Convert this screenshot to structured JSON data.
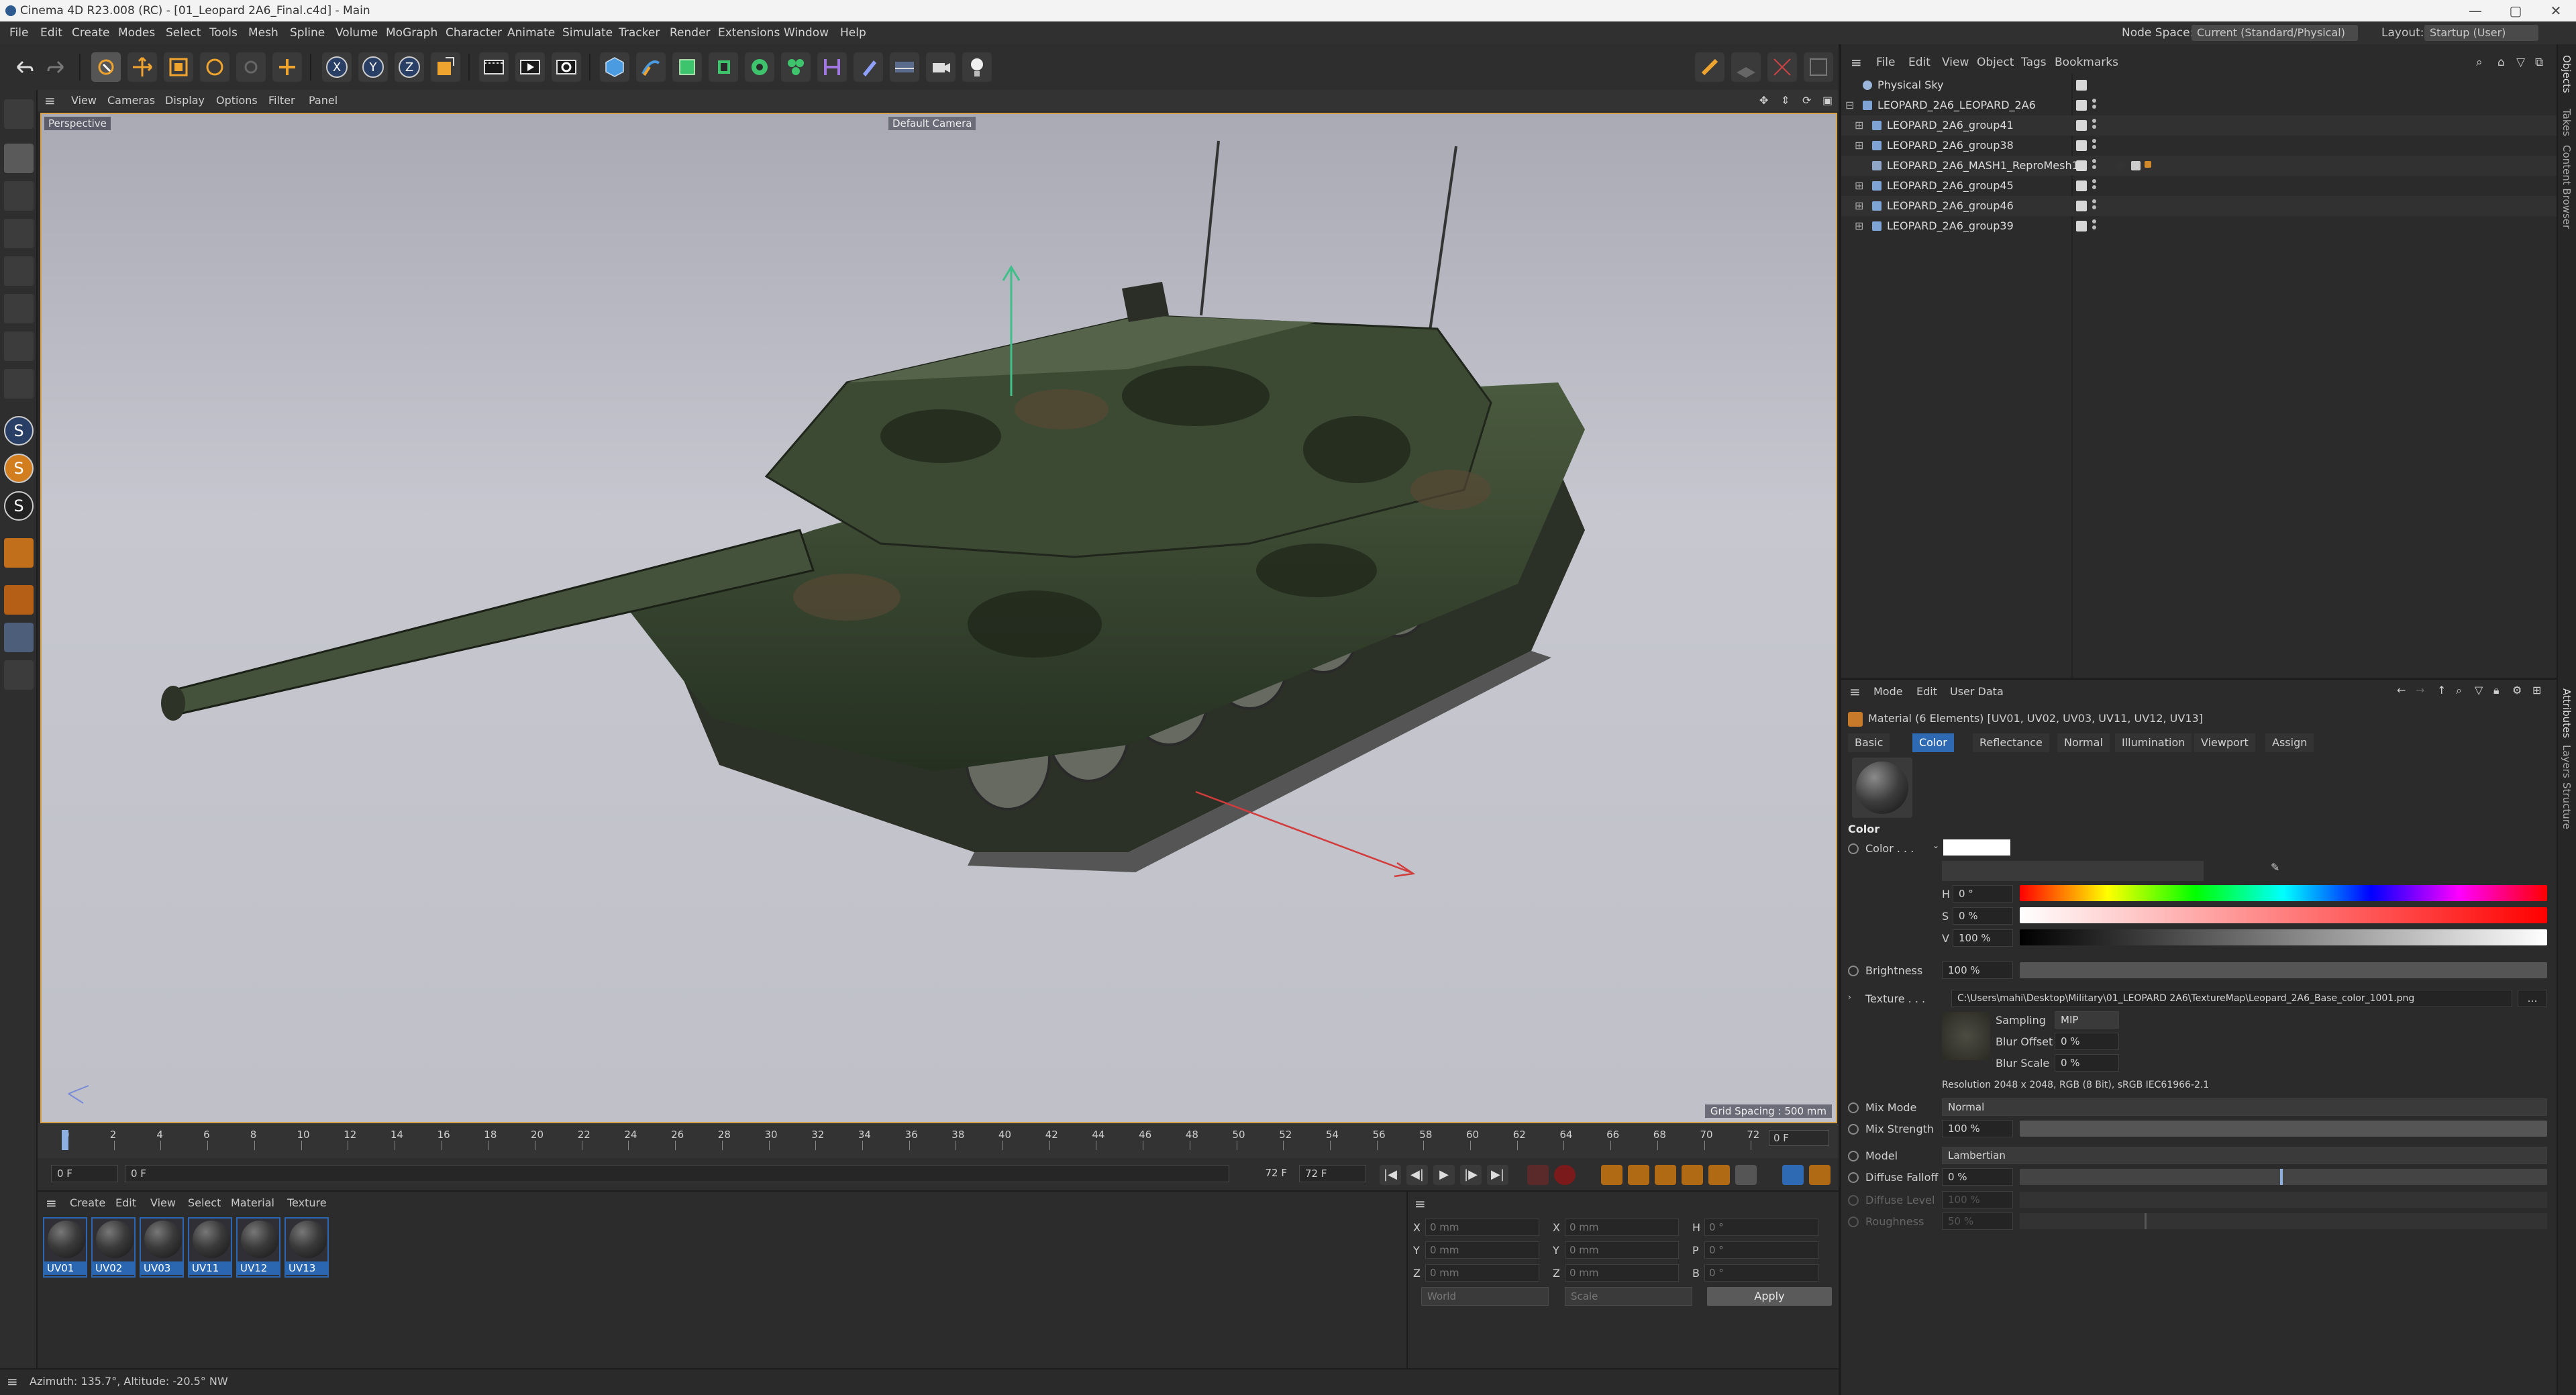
{
  "window": {
    "title": "Cinema 4D R23.008 (RC) - [01_Leopard 2A6_Final.c4d] - Main",
    "controls": [
      "—",
      "▢",
      "✕"
    ]
  },
  "menubar": {
    "items": [
      "File",
      "Edit",
      "Create",
      "Modes",
      "Select",
      "Tools",
      "Mesh",
      "Spline",
      "Volume",
      "MoGraph",
      "Character",
      "Animate",
      "Simulate",
      "Tracker",
      "Render",
      "Extensions",
      "Window",
      "Help"
    ],
    "node_space_label": "Node Space:",
    "node_space_value": "Current (Standard/Physical)",
    "layout_label": "Layout:",
    "layout_value": "Startup (User)"
  },
  "toolbar": {
    "axis_x": "X",
    "axis_y": "Y",
    "axis_z": "Z",
    "icons": [
      "undo-icon",
      "redo-icon",
      "select-icon",
      "move-icon",
      "scale-icon",
      "rotate-icon",
      "live-select-icon",
      "add-icon",
      "x-axis-icon",
      "y-axis-icon",
      "z-axis-icon",
      "coord-system-icon",
      "render-region-icon",
      "render-view-icon",
      "render-settings-icon",
      "cube-icon",
      "pen-icon",
      "subdivision-icon",
      "extrude-icon",
      "cloner-icon",
      "mograph-icon",
      "deformer-icon",
      "field-icon",
      "environment-icon",
      "camera-icon",
      "light-icon"
    ]
  },
  "lefttools": {
    "snap_labels": [
      "S",
      "S",
      "S"
    ]
  },
  "viewport": {
    "menu": [
      "View",
      "Cameras",
      "Display",
      "Options",
      "Filter",
      "Panel"
    ],
    "view_name": "Perspective",
    "camera": "Default Camera",
    "grid_spacing": "Grid Spacing : 500 mm",
    "colors": {
      "axis_y": "#3fbf8a",
      "axis_x": "#d23c3c"
    }
  },
  "timeline": {
    "ticks": [
      "0",
      "2",
      "4",
      "6",
      "8",
      "10",
      "12",
      "14",
      "16",
      "18",
      "20",
      "22",
      "24",
      "26",
      "28",
      "30",
      "32",
      "34",
      "36",
      "38",
      "40",
      "42",
      "44",
      "46",
      "48",
      "50",
      "52",
      "54",
      "56",
      "58",
      "60",
      "62",
      "64",
      "66",
      "68",
      "70",
      "72"
    ],
    "current_frame": "0 F",
    "start_field": "0 F",
    "min_field": "0 F",
    "end_field": "72 F",
    "max_field": "72 F",
    "transport": [
      "|◀",
      "◀|",
      "▶",
      "|▶",
      "▶|"
    ]
  },
  "material_manager": {
    "menu": [
      "Create",
      "Edit",
      "View",
      "Select",
      "Material",
      "Texture"
    ],
    "materials": [
      "UV01",
      "UV02",
      "UV03",
      "UV11",
      "UV12",
      "UV13"
    ]
  },
  "coordinates": {
    "rows": [
      {
        "a_label": "X",
        "a_value": "0 mm",
        "b_label": "X",
        "b_value": "0 mm",
        "c_label": "H",
        "c_value": "0 °"
      },
      {
        "a_label": "Y",
        "a_value": "0 mm",
        "b_label": "Y",
        "b_value": "0 mm",
        "c_label": "P",
        "c_value": "0 °"
      },
      {
        "a_label": "Z",
        "a_value": "0 mm",
        "b_label": "Z",
        "b_value": "0 mm",
        "c_label": "B",
        "c_value": "0 °"
      }
    ],
    "space": "World",
    "mode": "Scale",
    "apply": "Apply"
  },
  "status": {
    "text": "Azimuth: 135.7°, Altitude: -20.5°  NW"
  },
  "object_manager": {
    "menu": [
      "File",
      "Edit",
      "View",
      "Object",
      "Tags",
      "Bookmarks"
    ],
    "objects": [
      {
        "name": "Physical Sky",
        "indent": 0
      },
      {
        "name": "LEOPARD_2A6_LEOPARD_2A6",
        "indent": 0
      },
      {
        "name": "LEOPARD_2A6_group41",
        "indent": 1
      },
      {
        "name": "LEOPARD_2A6_group38",
        "indent": 1
      },
      {
        "name": "LEOPARD_2A6_MASH1_ReproMesh1",
        "indent": 1
      },
      {
        "name": "LEOPARD_2A6_group45",
        "indent": 1
      },
      {
        "name": "LEOPARD_2A6_group46",
        "indent": 1
      },
      {
        "name": "LEOPARD_2A6_group39",
        "indent": 1
      }
    ]
  },
  "attributes": {
    "menu": [
      "Mode",
      "Edit",
      "User Data"
    ],
    "header": "Material (6 Elements) [UV01, UV02, UV03, UV11, UV12, UV13]",
    "tabs": [
      "Basic",
      "Color",
      "Reflectance",
      "Normal",
      "Illumination",
      "Viewport",
      "Assign"
    ],
    "active_tab": "Color",
    "section": "Color",
    "color_label": "Color . . .",
    "h_label": "H",
    "h_value": "0 °",
    "s_label": "S",
    "s_value": "0 %",
    "v_label": "V",
    "v_value": "100 %",
    "brightness_label": "Brightness",
    "brightness_value": "100 %",
    "texture_label": "Texture . . .",
    "texture_path": "C:\\Users\\mahi\\Desktop\\Military\\01_LEOPARD 2A6\\TextureMap\\Leopard_2A6_Base_color_1001.png",
    "sampling_label": "Sampling",
    "sampling_value": "MIP",
    "blur_offset_label": "Blur Offset",
    "blur_offset_value": "0 %",
    "blur_scale_label": "Blur Scale",
    "blur_scale_value": "0 %",
    "resolution": "Resolution 2048 x 2048, RGB (8 Bit), sRGB IEC61966-2.1",
    "mix_mode_label": "Mix Mode",
    "mix_mode_value": "Normal",
    "mix_strength_label": "Mix Strength",
    "mix_strength_value": "100 %",
    "model_label": "Model",
    "model_value": "Lambertian",
    "diffuse_falloff_label": "Diffuse Falloff",
    "diffuse_falloff_value": "0 %",
    "diffuse_level_label": "Diffuse Level",
    "diffuse_level_value": "100 %",
    "roughness_label": "Roughness",
    "roughness_value": "50 %",
    "colors": {
      "tab_active": "#2e6ab3",
      "swatch": "#ffffff"
    }
  },
  "side_tabs": {
    "top": [
      "Objects",
      "Takes",
      "Content Browser"
    ],
    "bottom": [
      "Attributes",
      "Layers",
      "Structure"
    ]
  }
}
